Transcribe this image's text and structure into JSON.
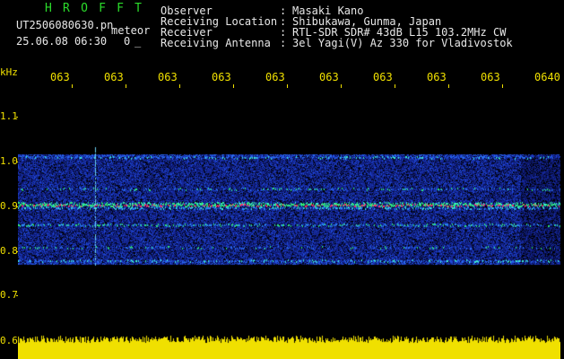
{
  "app": {
    "logo_letters": [
      "H",
      "R",
      "O",
      "F",
      "F",
      "T"
    ],
    "filename": "UT2506080630.pn",
    "mode_label": "meteor",
    "datetime": "25.06.08 06:30",
    "status_value": "0",
    "status_mark": "_"
  },
  "info": [
    {
      "label": "Observer",
      "value": "Masaki Kano"
    },
    {
      "label": "Receiving Location",
      "value": "Shibukawa, Gunma, Japan"
    },
    {
      "label": "Receiver",
      "value": "RTL-SDR SDR# 43dB L15 103.2MHz CW"
    },
    {
      "label": "Receiving Antenna",
      "value": "3el Yagi(V) Az 330 for Vladivostok"
    }
  ],
  "separator": ":",
  "axis": {
    "unit": "kHz",
    "y_ticks": [
      "1.1",
      "1.0",
      "0.9",
      "0.8",
      "0.7",
      "0.6"
    ],
    "x_ticks": [
      "063",
      "063",
      "063",
      "063",
      "063",
      "063",
      "063",
      "063",
      "063",
      "0640"
    ]
  },
  "colors": {
    "background": "#000000",
    "axis": "#f0e000",
    "text": "#e8e8e8",
    "logo": "#2bdc2b",
    "signal_hot": "#ff2a6a",
    "signal_warm": "#2ee87a",
    "noise": "#1b3cc8"
  }
}
